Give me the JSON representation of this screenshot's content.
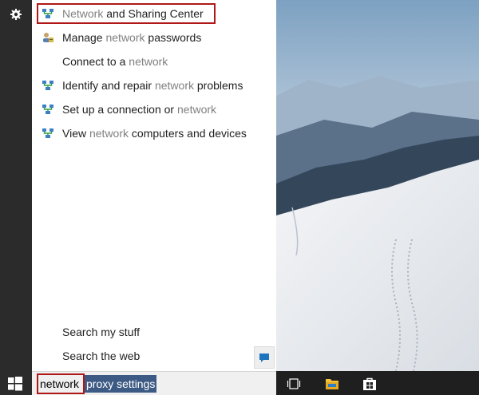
{
  "rail": {
    "settings_icon": "gear-icon",
    "start_icon": "windows-logo-icon"
  },
  "results": [
    {
      "icon": "network-icon",
      "pre": "",
      "hl": "Network",
      "post": " and Sharing Center",
      "boxed": true
    },
    {
      "icon": "credential-icon",
      "pre": "Manage ",
      "hl": "network",
      "post": " passwords",
      "boxed": false
    },
    {
      "icon": "",
      "pre": "Connect to a ",
      "hl": "network",
      "post": "",
      "boxed": false
    },
    {
      "icon": "network-icon",
      "pre": "Identify and repair ",
      "hl": "network",
      "post": " problems",
      "boxed": false
    },
    {
      "icon": "network-icon",
      "pre": "Set up a connection or ",
      "hl": "network",
      "post": "",
      "boxed": false
    },
    {
      "icon": "network-icon",
      "pre": "View ",
      "hl": "network",
      "post": " computers and devices",
      "boxed": false
    }
  ],
  "search_links": {
    "my_stuff": "Search my stuff",
    "web": "Search the web"
  },
  "feedback_icon": "feedback-icon",
  "searchbox": {
    "typed": "network",
    "suggested": "proxy settings"
  },
  "taskbar": {
    "icons": [
      "task-view-icon",
      "file-explorer-icon",
      "store-icon"
    ]
  },
  "colors": {
    "highlight_border": "#b01818",
    "selection": "#3d5a84",
    "matched_text": "#808080"
  }
}
